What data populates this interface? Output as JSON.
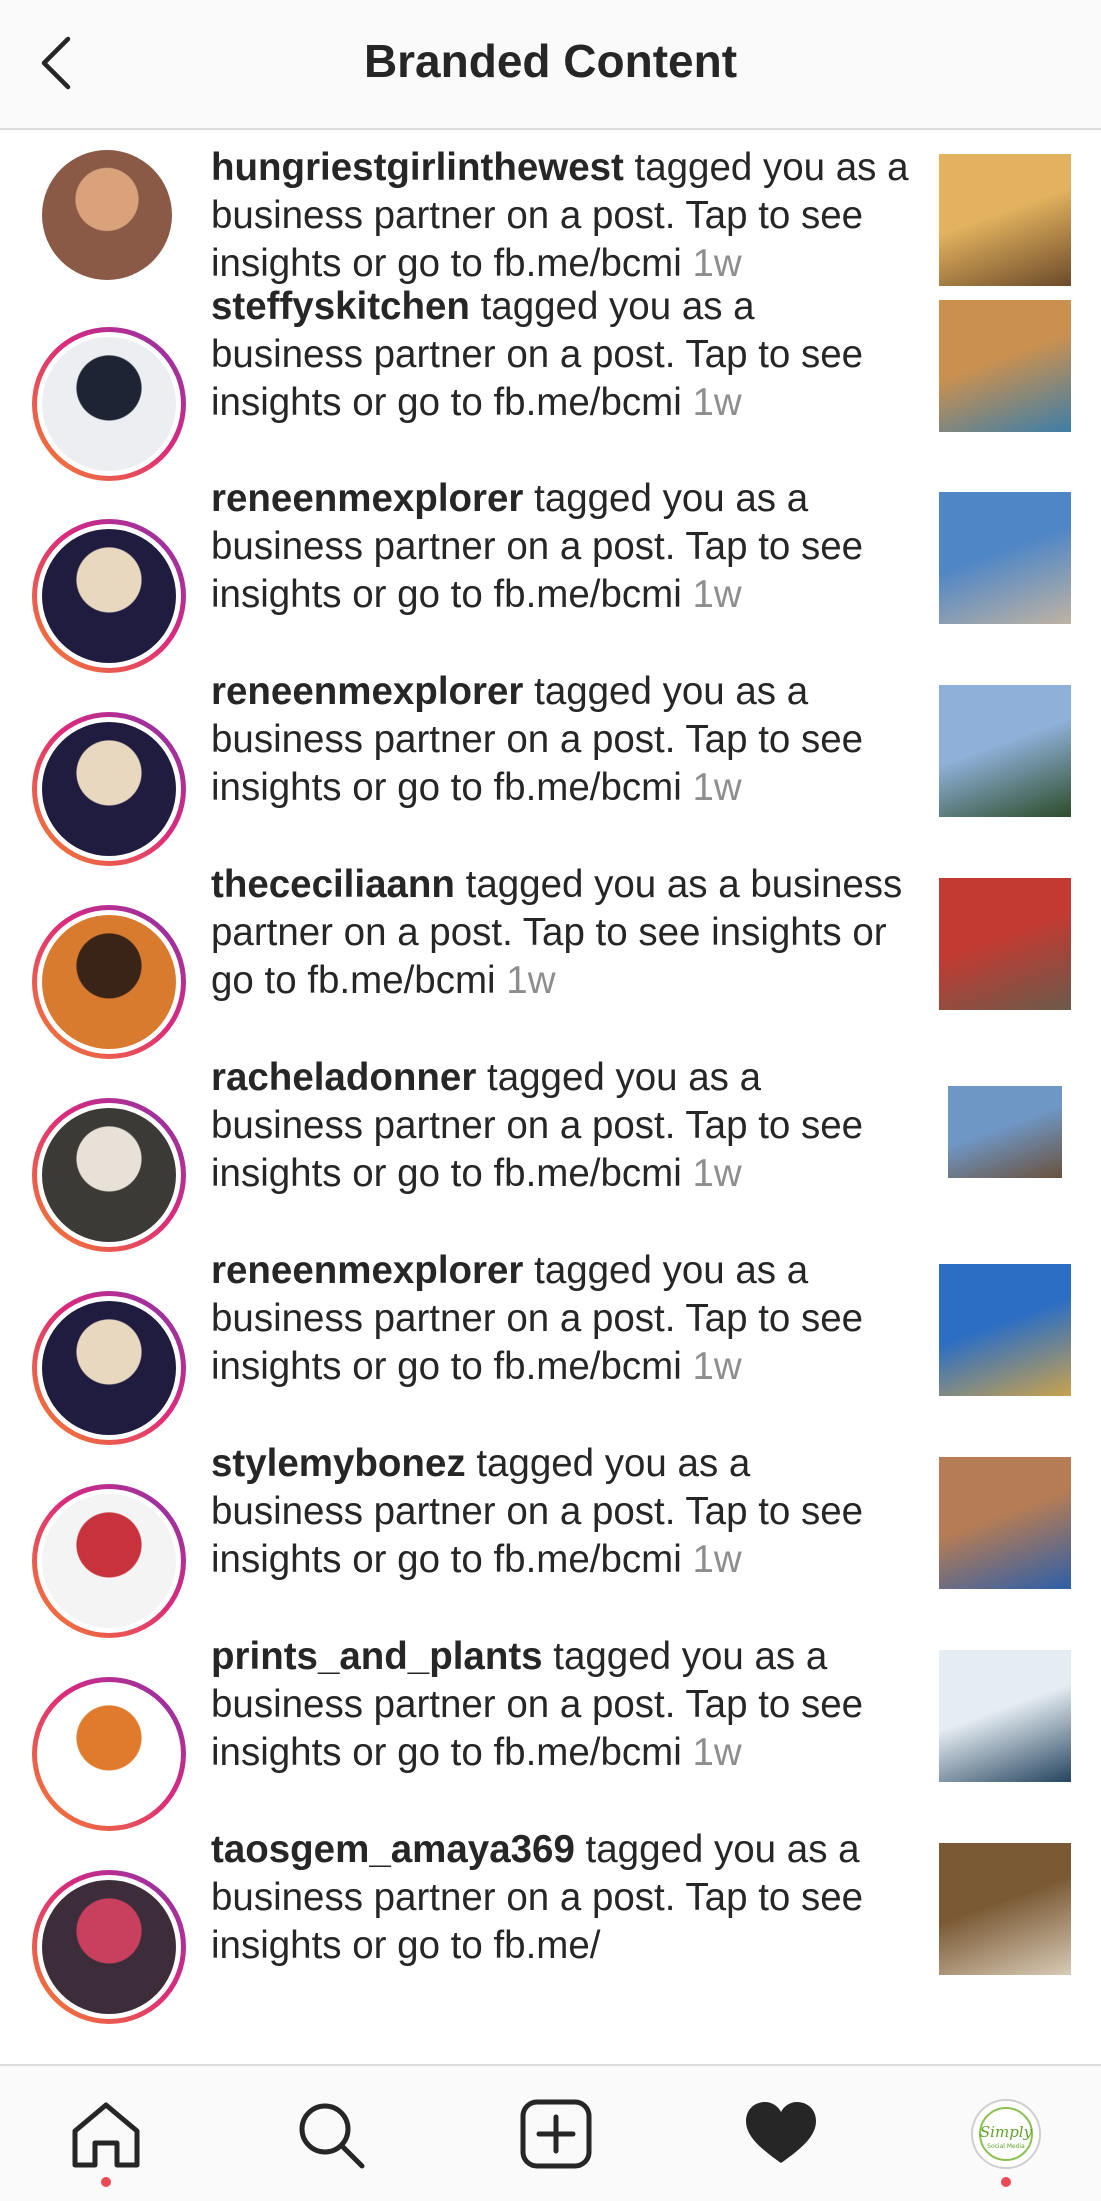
{
  "header": {
    "title": "Branded Content"
  },
  "message_suffix": " tagged you as a business partner on a post. Tap to see insights or go to fb.me/bcmi ",
  "notifications": [
    {
      "username": "hungriestgirlinthewest",
      "time": "1w",
      "avatar_style": "plain",
      "avatar_colors": [
        "#8a5a46",
        "#d9a27b"
      ],
      "thumb_colors": [
        "#e2b25e",
        "#6b4a2a"
      ]
    },
    {
      "username": "steffyskitchen",
      "time": "1w",
      "avatar_style": "ring",
      "avatar_colors": [
        "#eceef2",
        "#1e2433"
      ],
      "thumb_colors": [
        "#c99050",
        "#3d7ea8"
      ]
    },
    {
      "username": "reneenmexplorer",
      "time": "1w",
      "avatar_style": "ring",
      "avatar_colors": [
        "#201c40",
        "#e7d8bf"
      ],
      "thumb_colors": [
        "#4f86c6",
        "#bfb3a3"
      ]
    },
    {
      "username": "reneenmexplorer",
      "time": "1w",
      "avatar_style": "ring",
      "avatar_colors": [
        "#201c40",
        "#e7d8bf"
      ],
      "thumb_colors": [
        "#8fb0d8",
        "#2d4c2a"
      ]
    },
    {
      "username": "thececiliaann",
      "time": "1w",
      "avatar_style": "ring",
      "avatar_colors": [
        "#d97b2f",
        "#3a2418"
      ],
      "thumb_colors": [
        "#c23a32",
        "#6b5b4b"
      ]
    },
    {
      "username": "racheladonner",
      "time": "1w",
      "avatar_style": "ring",
      "avatar_colors": [
        "#3b3a36",
        "#e8e1d7"
      ],
      "thumb_colors": [
        "#6f97c6",
        "#6a513c"
      ]
    },
    {
      "username": "reneenmexplorer",
      "time": "1w",
      "avatar_style": "ring",
      "avatar_colors": [
        "#201c40",
        "#e7d8bf"
      ],
      "thumb_colors": [
        "#2c6ec4",
        "#c9a24e"
      ]
    },
    {
      "username": "stylemybonez",
      "time": "1w",
      "avatar_style": "ring",
      "avatar_colors": [
        "#f4f4f4",
        "#c8323c"
      ],
      "thumb_colors": [
        "#b57c55",
        "#2e5fa8"
      ]
    },
    {
      "username": "prints_and_plants",
      "time": "1w",
      "avatar_style": "ring",
      "avatar_colors": [
        "#ffffff",
        "#e07b2d"
      ],
      "thumb_colors": [
        "#e6edf2",
        "#25445f"
      ]
    },
    {
      "username": "taosgem_amaya369",
      "time": "",
      "avatar_style": "ring",
      "avatar_colors": [
        "#3d2d3a",
        "#c9405e"
      ],
      "thumb_colors": [
        "#7a5a35",
        "#d8cab6"
      ]
    }
  ],
  "partial_text": " tagged you as a business partner on a post. Tap to see insights or go to fb.me/",
  "nav": {
    "items": [
      "home",
      "search",
      "new-post",
      "activity",
      "profile"
    ],
    "profile_badge": "Simply",
    "profile_badge_sub": "Social Media",
    "dot_color": "#ed4956"
  }
}
